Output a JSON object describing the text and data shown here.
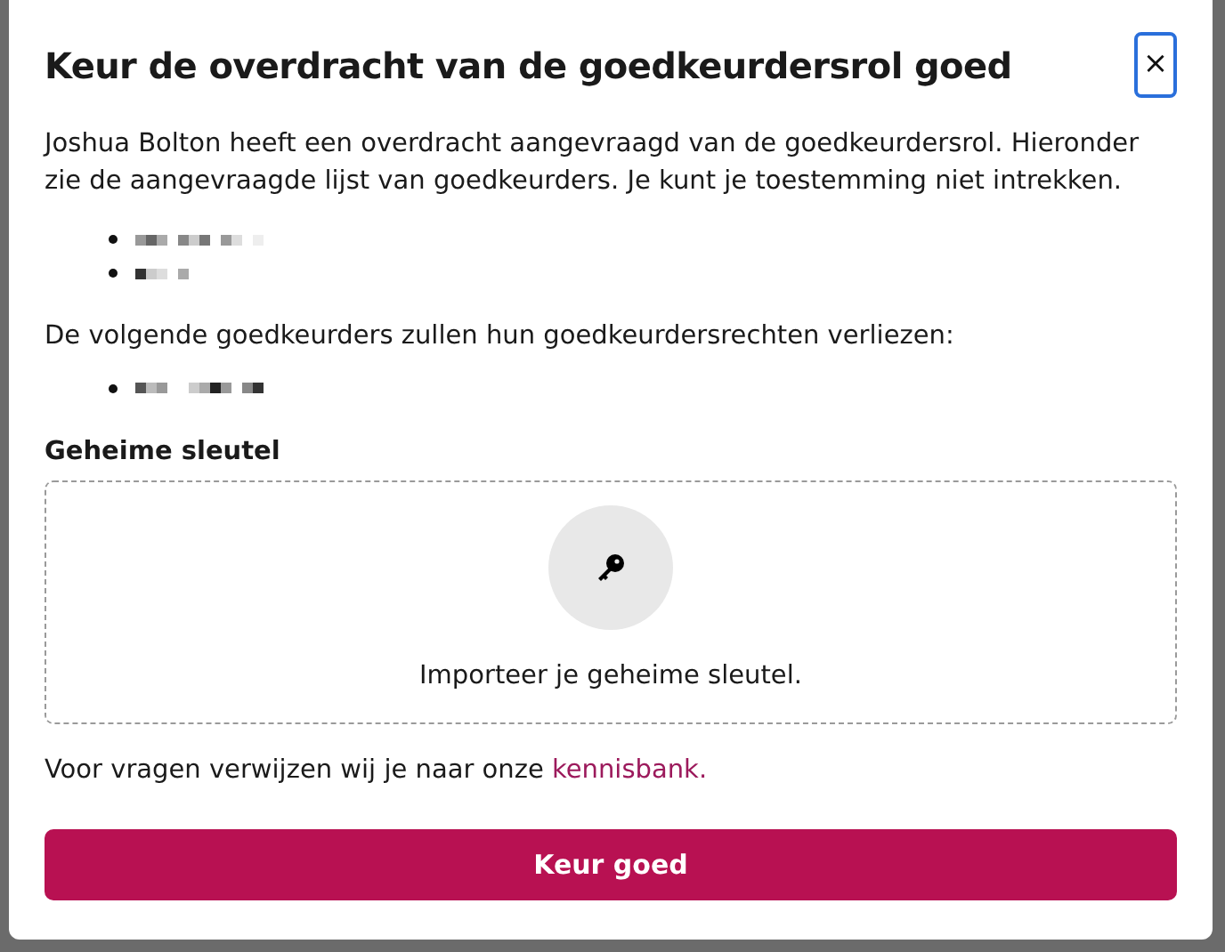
{
  "dialog": {
    "title": "Keur de overdracht van de goedkeurdersrol goed",
    "close": "×",
    "intro": "Joshua Bolton heeft een overdracht aangevraagd van de goedkeurdersrol. Hieronder zie de aangevraagde lijst van goedkeurders. Je kunt je toestemming niet intrekken.",
    "requested_approvers": [
      {
        "kind": "redacted"
      },
      {
        "kind": "redacted"
      }
    ],
    "losing_label": "De volgende goedkeurders zullen hun goedkeurdersrechten verliezen:",
    "losing_approvers": [
      {
        "kind": "redacted"
      }
    ],
    "key_label": "Geheime sleutel",
    "key_drop": {
      "text": "Importeer je geheime sleutel."
    },
    "help": {
      "text": "Voor vragen verwijzen wij je naar onze ",
      "link": "kennisbank."
    },
    "submit": "Keur goed"
  }
}
